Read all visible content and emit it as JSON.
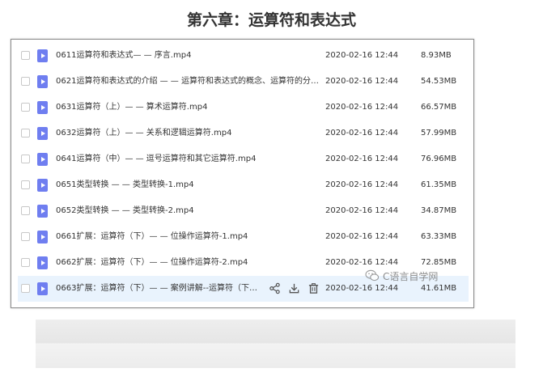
{
  "heading": "第六章：运算符和表达式",
  "files": [
    {
      "name": "0611运算符和表达式— — 序言.mp4",
      "date": "2020-02-16 12:44",
      "size": "8.93MB"
    },
    {
      "name": "0621运算符和表达式的介绍 — — 运算符和表达式的概念、运算符的分类...",
      "date": "2020-02-16 12:44",
      "size": "54.53MB"
    },
    {
      "name": "0631运算符（上）— — 算术运算符.mp4",
      "date": "2020-02-16 12:44",
      "size": "66.57MB"
    },
    {
      "name": "0632运算符（上）— — 关系和逻辑运算符.mp4",
      "date": "2020-02-16 12:44",
      "size": "57.99MB"
    },
    {
      "name": "0641运算符（中）— — 逗号运算符和其它运算符.mp4",
      "date": "2020-02-16 12:44",
      "size": "76.96MB"
    },
    {
      "name": "0651类型转换 — — 类型转换-1.mp4",
      "date": "2020-02-16 12:44",
      "size": "61.35MB"
    },
    {
      "name": "0652类型转换 — — 类型转换-2.mp4",
      "date": "2020-02-16 12:44",
      "size": "34.87MB"
    },
    {
      "name": "0661扩展：运算符（下）— — 位操作运算符-1.mp4",
      "date": "2020-02-16 12:44",
      "size": "63.33MB"
    },
    {
      "name": "0662扩展：运算符（下）— — 位操作运算符-2.mp4",
      "date": "2020-02-16 12:44",
      "size": "72.85MB"
    },
    {
      "name": "0663扩展：运算符（下）— — 案例讲解--运算符（下）...",
      "date": "2020-02-16 12:44",
      "size": "41.61MB",
      "hovered": true
    }
  ],
  "row_actions": [
    "share-icon",
    "download-icon",
    "delete-icon"
  ],
  "watermark": "C语言自学网",
  "colors": {
    "file_icon": "#6f7ef0",
    "hover_row": "#e9f3fd",
    "accent": "#3b7be8"
  }
}
